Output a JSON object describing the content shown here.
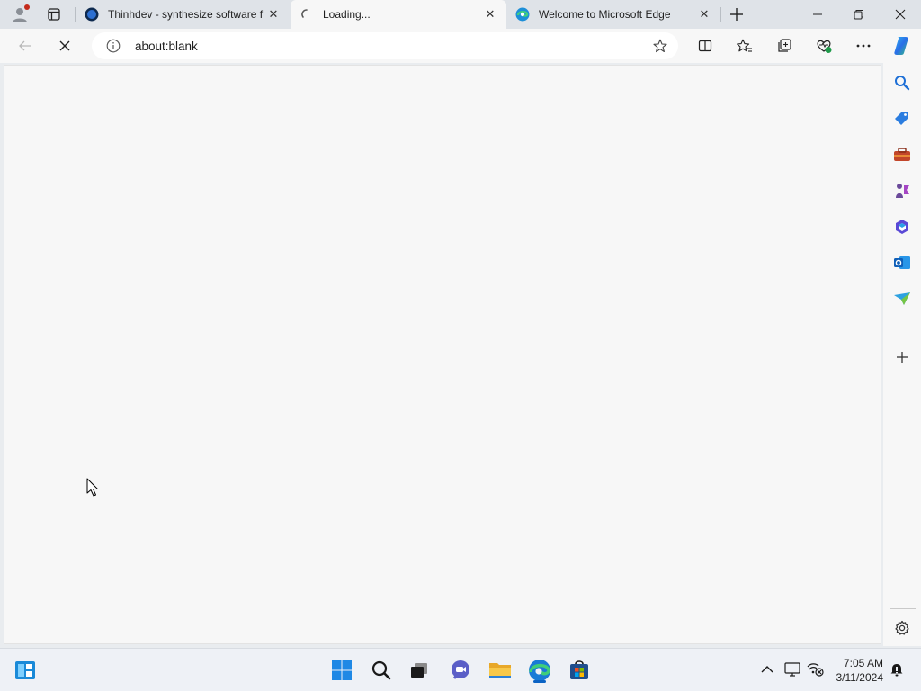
{
  "browser": {
    "tabs": [
      {
        "title": "Thinhdev - synthesize software f",
        "active": false
      },
      {
        "title": "Loading...",
        "active": true
      },
      {
        "title": "Welcome to Microsoft Edge",
        "active": false
      }
    ],
    "address_bar": {
      "url": "about:blank"
    },
    "accent": "#0b63c4"
  },
  "toolbar_icons": [
    "back-icon",
    "stop-icon",
    "split-screen-icon",
    "favorites-icon",
    "collections-icon",
    "browser-essentials-icon",
    "more-icon",
    "copilot-icon"
  ],
  "sidebar_icons": [
    "search-icon",
    "shopping-icon",
    "tools-icon",
    "games-icon",
    "microsoft-365-icon",
    "outlook-icon",
    "drop-icon",
    "add-icon",
    "settings-icon"
  ],
  "taskbar": {
    "apps": [
      "start-icon",
      "search-icon",
      "task-view-icon",
      "teams-chat-icon",
      "file-explorer-icon",
      "edge-icon",
      "store-icon"
    ],
    "clock": {
      "time": "7:05 AM",
      "date": "3/11/2024"
    }
  }
}
